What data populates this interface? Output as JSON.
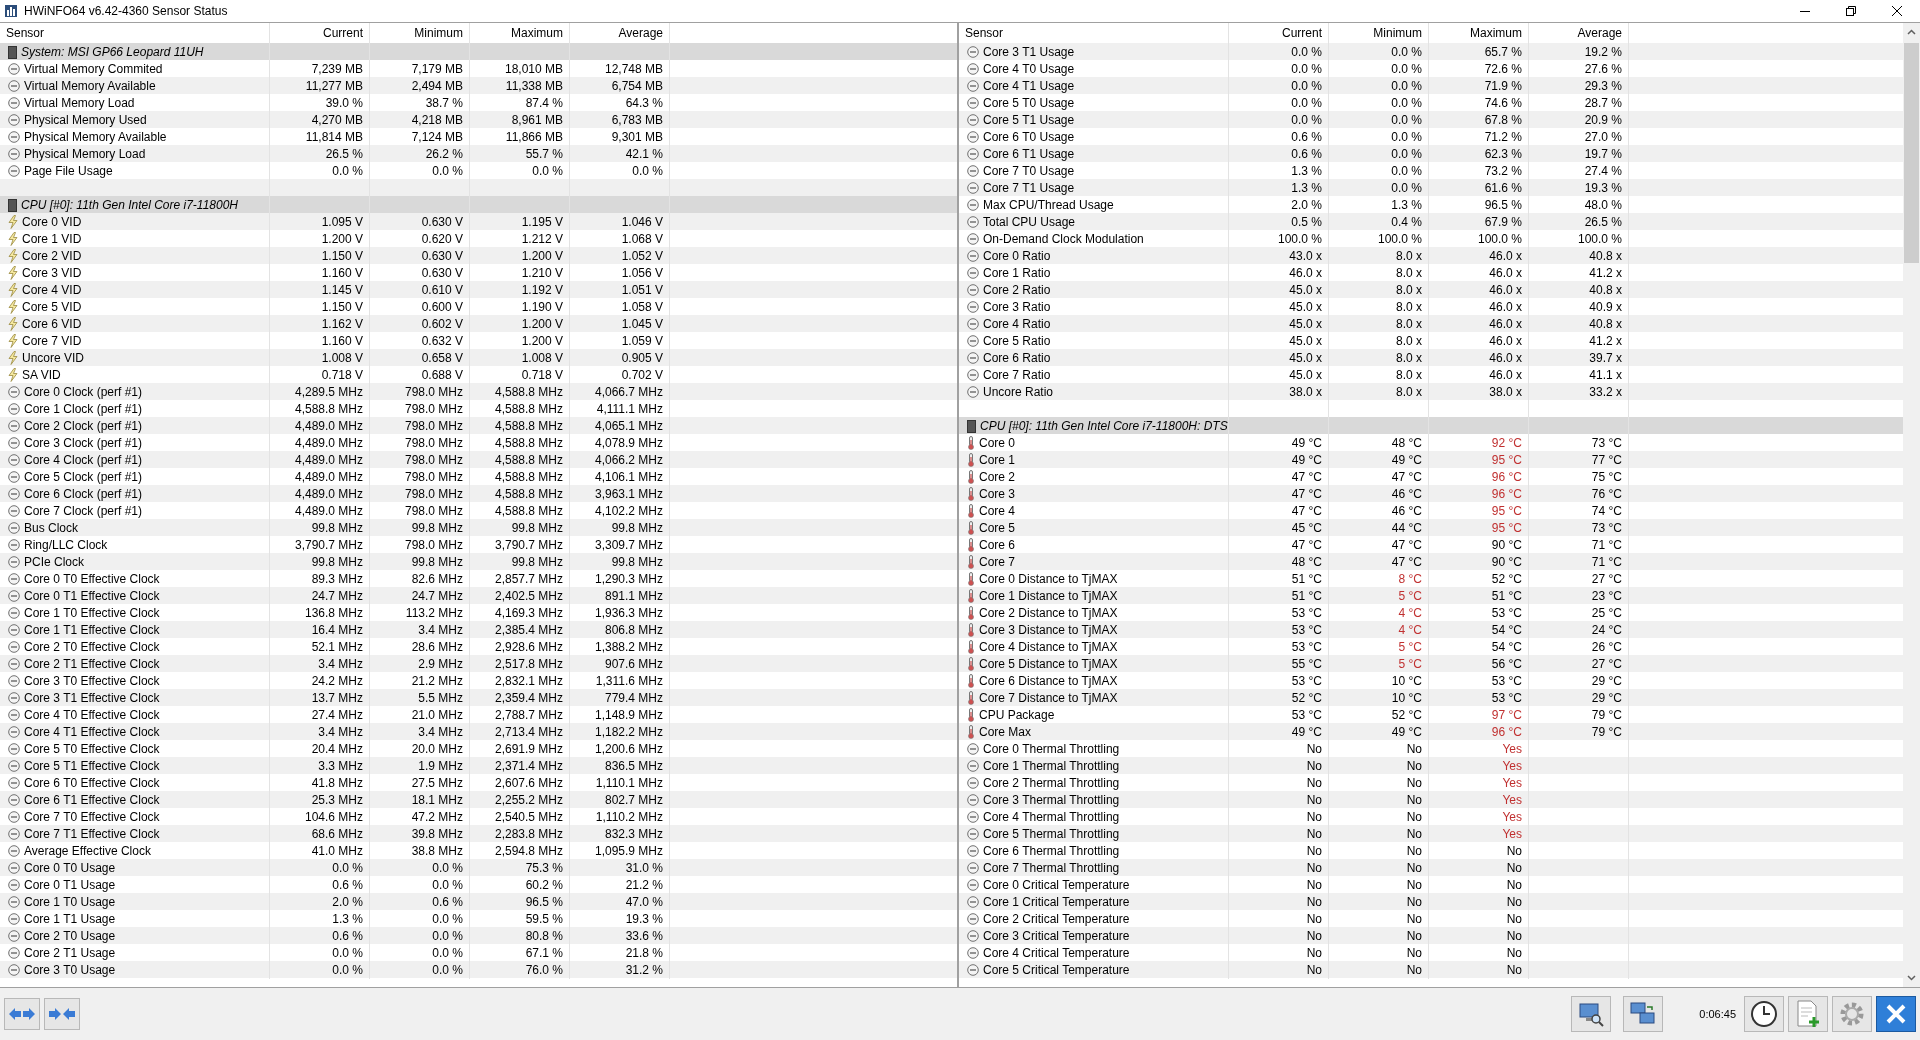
{
  "window": {
    "title": "HWiNFO64 v6.42-4360 Sensor Status"
  },
  "panels": [
    {
      "columns": [
        "Sensor",
        "Current",
        "Minimum",
        "Maximum",
        "Average"
      ],
      "rows": [
        {
          "kind": "group",
          "label": "System: MSI GP66 Leopard 11UH"
        },
        {
          "kind": "gauge",
          "label": "Virtual Memory Commited",
          "current": "7,239 MB",
          "minimum": "7,179 MB",
          "maximum": "18,010 MB",
          "average": "12,748 MB"
        },
        {
          "kind": "gauge",
          "label": "Virtual Memory Available",
          "current": "11,277 MB",
          "minimum": "2,494 MB",
          "maximum": "11,338 MB",
          "average": "6,754 MB"
        },
        {
          "kind": "gauge",
          "label": "Virtual Memory Load",
          "current": "39.0 %",
          "minimum": "38.7 %",
          "maximum": "87.4 %",
          "average": "64.3 %"
        },
        {
          "kind": "gauge",
          "label": "Physical Memory Used",
          "current": "4,270 MB",
          "minimum": "4,218 MB",
          "maximum": "8,961 MB",
          "average": "6,783 MB"
        },
        {
          "kind": "gauge",
          "label": "Physical Memory Available",
          "current": "11,814 MB",
          "minimum": "7,124 MB",
          "maximum": "11,866 MB",
          "average": "9,301 MB"
        },
        {
          "kind": "gauge",
          "label": "Physical Memory Load",
          "current": "26.5 %",
          "minimum": "26.2 %",
          "maximum": "55.7 %",
          "average": "42.1 %"
        },
        {
          "kind": "gauge",
          "label": "Page File Usage",
          "current": "0.0 %",
          "minimum": "0.0 %",
          "maximum": "0.0 %",
          "average": "0.0 %"
        },
        {
          "kind": "blank"
        },
        {
          "kind": "group",
          "label": "CPU [#0]: 11th Gen Intel Core i7-11800H"
        },
        {
          "kind": "voltage",
          "label": "Core 0 VID",
          "current": "1.095 V",
          "minimum": "0.630 V",
          "maximum": "1.195 V",
          "average": "1.046 V"
        },
        {
          "kind": "voltage",
          "label": "Core 1 VID",
          "current": "1.200 V",
          "minimum": "0.620 V",
          "maximum": "1.212 V",
          "average": "1.068 V"
        },
        {
          "kind": "voltage",
          "label": "Core 2 VID",
          "current": "1.150 V",
          "minimum": "0.630 V",
          "maximum": "1.200 V",
          "average": "1.052 V"
        },
        {
          "kind": "voltage",
          "label": "Core 3 VID",
          "current": "1.160 V",
          "minimum": "0.630 V",
          "maximum": "1.210 V",
          "average": "1.056 V"
        },
        {
          "kind": "voltage",
          "label": "Core 4 VID",
          "current": "1.145 V",
          "minimum": "0.610 V",
          "maximum": "1.192 V",
          "average": "1.051 V"
        },
        {
          "kind": "voltage",
          "label": "Core 5 VID",
          "current": "1.150 V",
          "minimum": "0.600 V",
          "maximum": "1.190 V",
          "average": "1.058 V"
        },
        {
          "kind": "voltage",
          "label": "Core 6 VID",
          "current": "1.162 V",
          "minimum": "0.602 V",
          "maximum": "1.200 V",
          "average": "1.045 V"
        },
        {
          "kind": "voltage",
          "label": "Core 7 VID",
          "current": "1.160 V",
          "minimum": "0.632 V",
          "maximum": "1.200 V",
          "average": "1.059 V"
        },
        {
          "kind": "voltage",
          "label": "Uncore VID",
          "current": "1.008 V",
          "minimum": "0.658 V",
          "maximum": "1.008 V",
          "average": "0.905 V"
        },
        {
          "kind": "voltage",
          "label": "SA VID",
          "current": "0.718 V",
          "minimum": "0.688 V",
          "maximum": "0.718 V",
          "average": "0.702 V"
        },
        {
          "kind": "gauge",
          "label": "Core 0 Clock (perf #1)",
          "current": "4,289.5 MHz",
          "minimum": "798.0 MHz",
          "maximum": "4,588.8 MHz",
          "average": "4,066.7 MHz"
        },
        {
          "kind": "gauge",
          "label": "Core 1 Clock (perf #1)",
          "current": "4,588.8 MHz",
          "minimum": "798.0 MHz",
          "maximum": "4,588.8 MHz",
          "average": "4,111.1 MHz"
        },
        {
          "kind": "gauge",
          "label": "Core 2 Clock (perf #1)",
          "current": "4,489.0 MHz",
          "minimum": "798.0 MHz",
          "maximum": "4,588.8 MHz",
          "average": "4,065.1 MHz"
        },
        {
          "kind": "gauge",
          "label": "Core 3 Clock (perf #1)",
          "current": "4,489.0 MHz",
          "minimum": "798.0 MHz",
          "maximum": "4,588.8 MHz",
          "average": "4,078.9 MHz"
        },
        {
          "kind": "gauge",
          "label": "Core 4 Clock (perf #1)",
          "current": "4,489.0 MHz",
          "minimum": "798.0 MHz",
          "maximum": "4,588.8 MHz",
          "average": "4,066.2 MHz"
        },
        {
          "kind": "gauge",
          "label": "Core 5 Clock (perf #1)",
          "current": "4,489.0 MHz",
          "minimum": "798.0 MHz",
          "maximum": "4,588.8 MHz",
          "average": "4,106.1 MHz"
        },
        {
          "kind": "gauge",
          "label": "Core 6 Clock (perf #1)",
          "current": "4,489.0 MHz",
          "minimum": "798.0 MHz",
          "maximum": "4,588.8 MHz",
          "average": "3,963.1 MHz"
        },
        {
          "kind": "gauge",
          "label": "Core 7 Clock (perf #1)",
          "current": "4,489.0 MHz",
          "minimum": "798.0 MHz",
          "maximum": "4,588.8 MHz",
          "average": "4,102.2 MHz"
        },
        {
          "kind": "gauge",
          "label": "Bus Clock",
          "current": "99.8 MHz",
          "minimum": "99.8 MHz",
          "maximum": "99.8 MHz",
          "average": "99.8 MHz"
        },
        {
          "kind": "gauge",
          "label": "Ring/LLC Clock",
          "current": "3,790.7 MHz",
          "minimum": "798.0 MHz",
          "maximum": "3,790.7 MHz",
          "average": "3,309.7 MHz"
        },
        {
          "kind": "gauge",
          "label": "PCIe Clock",
          "current": "99.8 MHz",
          "minimum": "99.8 MHz",
          "maximum": "99.8 MHz",
          "average": "99.8 MHz"
        },
        {
          "kind": "gauge",
          "label": "Core 0 T0 Effective Clock",
          "current": "89.3 MHz",
          "minimum": "82.6 MHz",
          "maximum": "2,857.7 MHz",
          "average": "1,290.3 MHz"
        },
        {
          "kind": "gauge",
          "label": "Core 0 T1 Effective Clock",
          "current": "24.7 MHz",
          "minimum": "24.7 MHz",
          "maximum": "2,402.5 MHz",
          "average": "891.1 MHz"
        },
        {
          "kind": "gauge",
          "label": "Core 1 T0 Effective Clock",
          "current": "136.8 MHz",
          "minimum": "113.2 MHz",
          "maximum": "4,169.3 MHz",
          "average": "1,936.3 MHz"
        },
        {
          "kind": "gauge",
          "label": "Core 1 T1 Effective Clock",
          "current": "16.4 MHz",
          "minimum": "3.4 MHz",
          "maximum": "2,385.4 MHz",
          "average": "806.8 MHz"
        },
        {
          "kind": "gauge",
          "label": "Core 2 T0 Effective Clock",
          "current": "52.1 MHz",
          "minimum": "28.6 MHz",
          "maximum": "2,928.6 MHz",
          "average": "1,388.2 MHz"
        },
        {
          "kind": "gauge",
          "label": "Core 2 T1 Effective Clock",
          "current": "3.4 MHz",
          "minimum": "2.9 MHz",
          "maximum": "2,517.8 MHz",
          "average": "907.6 MHz"
        },
        {
          "kind": "gauge",
          "label": "Core 3 T0 Effective Clock",
          "current": "24.2 MHz",
          "minimum": "21.2 MHz",
          "maximum": "2,832.1 MHz",
          "average": "1,311.6 MHz"
        },
        {
          "kind": "gauge",
          "label": "Core 3 T1 Effective Clock",
          "current": "13.7 MHz",
          "minimum": "5.5 MHz",
          "maximum": "2,359.4 MHz",
          "average": "779.4 MHz"
        },
        {
          "kind": "gauge",
          "label": "Core 4 T0 Effective Clock",
          "current": "27.4 MHz",
          "minimum": "21.0 MHz",
          "maximum": "2,788.7 MHz",
          "average": "1,148.9 MHz"
        },
        {
          "kind": "gauge",
          "label": "Core 4 T1 Effective Clock",
          "current": "3.4 MHz",
          "minimum": "3.4 MHz",
          "maximum": "2,713.4 MHz",
          "average": "1,182.2 MHz"
        },
        {
          "kind": "gauge",
          "label": "Core 5 T0 Effective Clock",
          "current": "20.4 MHz",
          "minimum": "20.0 MHz",
          "maximum": "2,691.9 MHz",
          "average": "1,200.6 MHz"
        },
        {
          "kind": "gauge",
          "label": "Core 5 T1 Effective Clock",
          "current": "3.3 MHz",
          "minimum": "1.9 MHz",
          "maximum": "2,371.4 MHz",
          "average": "836.5 MHz"
        },
        {
          "kind": "gauge",
          "label": "Core 6 T0 Effective Clock",
          "current": "41.8 MHz",
          "minimum": "27.5 MHz",
          "maximum": "2,607.6 MHz",
          "average": "1,110.1 MHz"
        },
        {
          "kind": "gauge",
          "label": "Core 6 T1 Effective Clock",
          "current": "25.3 MHz",
          "minimum": "18.1 MHz",
          "maximum": "2,255.2 MHz",
          "average": "802.7 MHz"
        },
        {
          "kind": "gauge",
          "label": "Core 7 T0 Effective Clock",
          "current": "104.6 MHz",
          "minimum": "47.2 MHz",
          "maximum": "2,540.5 MHz",
          "average": "1,110.2 MHz"
        },
        {
          "kind": "gauge",
          "label": "Core 7 T1 Effective Clock",
          "current": "68.6 MHz",
          "minimum": "39.8 MHz",
          "maximum": "2,283.8 MHz",
          "average": "832.3 MHz"
        },
        {
          "kind": "gauge",
          "label": "Average Effective Clock",
          "current": "41.0 MHz",
          "minimum": "38.8 MHz",
          "maximum": "2,594.8 MHz",
          "average": "1,095.9 MHz"
        },
        {
          "kind": "gauge",
          "label": "Core 0 T0 Usage",
          "current": "0.0 %",
          "minimum": "0.0 %",
          "maximum": "75.3 %",
          "average": "31.0 %"
        },
        {
          "kind": "gauge",
          "label": "Core 0 T1 Usage",
          "current": "0.6 %",
          "minimum": "0.0 %",
          "maximum": "60.2 %",
          "average": "21.2 %"
        },
        {
          "kind": "gauge",
          "label": "Core 1 T0 Usage",
          "current": "2.0 %",
          "minimum": "0.6 %",
          "maximum": "96.5 %",
          "average": "47.0 %"
        },
        {
          "kind": "gauge",
          "label": "Core 1 T1 Usage",
          "current": "1.3 %",
          "minimum": "0.0 %",
          "maximum": "59.5 %",
          "average": "19.3 %"
        },
        {
          "kind": "gauge",
          "label": "Core 2 T0 Usage",
          "current": "0.6 %",
          "minimum": "0.0 %",
          "maximum": "80.8 %",
          "average": "33.6 %"
        },
        {
          "kind": "gauge",
          "label": "Core 2 T1 Usage",
          "current": "0.0 %",
          "minimum": "0.0 %",
          "maximum": "67.1 %",
          "average": "21.8 %"
        },
        {
          "kind": "gauge",
          "label": "Core 3 T0 Usage",
          "current": "0.0 %",
          "minimum": "0.0 %",
          "maximum": "76.0 %",
          "average": "31.2 %"
        }
      ]
    },
    {
      "columns": [
        "Sensor",
        "Current",
        "Minimum",
        "Maximum",
        "Average"
      ],
      "rows": [
        {
          "kind": "gauge",
          "label": "Core 3 T1 Usage",
          "current": "0.0 %",
          "minimum": "0.0 %",
          "maximum": "65.7 %",
          "average": "19.2 %"
        },
        {
          "kind": "gauge",
          "label": "Core 4 T0 Usage",
          "current": "0.0 %",
          "minimum": "0.0 %",
          "maximum": "72.6 %",
          "average": "27.6 %"
        },
        {
          "kind": "gauge",
          "label": "Core 4 T1 Usage",
          "current": "0.0 %",
          "minimum": "0.0 %",
          "maximum": "71.9 %",
          "average": "29.3 %"
        },
        {
          "kind": "gauge",
          "label": "Core 5 T0 Usage",
          "current": "0.0 %",
          "minimum": "0.0 %",
          "maximum": "74.6 %",
          "average": "28.7 %"
        },
        {
          "kind": "gauge",
          "label": "Core 5 T1 Usage",
          "current": "0.0 %",
          "minimum": "0.0 %",
          "maximum": "67.8 %",
          "average": "20.9 %"
        },
        {
          "kind": "gauge",
          "label": "Core 6 T0 Usage",
          "current": "0.6 %",
          "minimum": "0.0 %",
          "maximum": "71.2 %",
          "average": "27.0 %"
        },
        {
          "kind": "gauge",
          "label": "Core 6 T1 Usage",
          "current": "0.6 %",
          "minimum": "0.0 %",
          "maximum": "62.3 %",
          "average": "19.7 %"
        },
        {
          "kind": "gauge",
          "label": "Core 7 T0 Usage",
          "current": "1.3 %",
          "minimum": "0.0 %",
          "maximum": "73.2 %",
          "average": "27.4 %"
        },
        {
          "kind": "gauge",
          "label": "Core 7 T1 Usage",
          "current": "1.3 %",
          "minimum": "0.0 %",
          "maximum": "61.6 %",
          "average": "19.3 %"
        },
        {
          "kind": "gauge",
          "label": "Max CPU/Thread Usage",
          "current": "2.0 %",
          "minimum": "1.3 %",
          "maximum": "96.5 %",
          "average": "48.0 %"
        },
        {
          "kind": "gauge",
          "label": "Total CPU Usage",
          "current": "0.5 %",
          "minimum": "0.4 %",
          "maximum": "67.9 %",
          "average": "26.5 %"
        },
        {
          "kind": "gauge",
          "label": "On-Demand Clock Modulation",
          "current": "100.0 %",
          "minimum": "100.0 %",
          "maximum": "100.0 %",
          "average": "100.0 %"
        },
        {
          "kind": "gauge",
          "label": "Core 0 Ratio",
          "current": "43.0 x",
          "minimum": "8.0 x",
          "maximum": "46.0 x",
          "average": "40.8 x"
        },
        {
          "kind": "gauge",
          "label": "Core 1 Ratio",
          "current": "46.0 x",
          "minimum": "8.0 x",
          "maximum": "46.0 x",
          "average": "41.2 x"
        },
        {
          "kind": "gauge",
          "label": "Core 2 Ratio",
          "current": "45.0 x",
          "minimum": "8.0 x",
          "maximum": "46.0 x",
          "average": "40.8 x"
        },
        {
          "kind": "gauge",
          "label": "Core 3 Ratio",
          "current": "45.0 x",
          "minimum": "8.0 x",
          "maximum": "46.0 x",
          "average": "40.9 x"
        },
        {
          "kind": "gauge",
          "label": "Core 4 Ratio",
          "current": "45.0 x",
          "minimum": "8.0 x",
          "maximum": "46.0 x",
          "average": "40.8 x"
        },
        {
          "kind": "gauge",
          "label": "Core 5 Ratio",
          "current": "45.0 x",
          "minimum": "8.0 x",
          "maximum": "46.0 x",
          "average": "41.2 x"
        },
        {
          "kind": "gauge",
          "label": "Core 6 Ratio",
          "current": "45.0 x",
          "minimum": "8.0 x",
          "maximum": "46.0 x",
          "average": "39.7 x"
        },
        {
          "kind": "gauge",
          "label": "Core 7 Ratio",
          "current": "45.0 x",
          "minimum": "8.0 x",
          "maximum": "46.0 x",
          "average": "41.1 x"
        },
        {
          "kind": "gauge",
          "label": "Uncore Ratio",
          "current": "38.0 x",
          "minimum": "8.0 x",
          "maximum": "38.0 x",
          "average": "33.2 x"
        },
        {
          "kind": "blank"
        },
        {
          "kind": "group",
          "label": "CPU [#0]: 11th Gen Intel Core i7-11800H: DTS"
        },
        {
          "kind": "temperature",
          "label": "Core 0",
          "current": "49 °C",
          "minimum": "48 °C",
          "maximum": "92 °C",
          "average": "73 °C",
          "min_alert": false,
          "max_alert": true
        },
        {
          "kind": "temperature",
          "label": "Core 1",
          "current": "49 °C",
          "minimum": "49 °C",
          "maximum": "95 °C",
          "average": "77 °C",
          "min_alert": false,
          "max_alert": true
        },
        {
          "kind": "temperature",
          "label": "Core 2",
          "current": "47 °C",
          "minimum": "47 °C",
          "maximum": "96 °C",
          "average": "75 °C",
          "min_alert": false,
          "max_alert": true
        },
        {
          "kind": "temperature",
          "label": "Core 3",
          "current": "47 °C",
          "minimum": "46 °C",
          "maximum": "96 °C",
          "average": "76 °C",
          "min_alert": false,
          "max_alert": true
        },
        {
          "kind": "temperature",
          "label": "Core 4",
          "current": "47 °C",
          "minimum": "46 °C",
          "maximum": "95 °C",
          "average": "74 °C",
          "min_alert": false,
          "max_alert": true
        },
        {
          "kind": "temperature",
          "label": "Core 5",
          "current": "45 °C",
          "minimum": "44 °C",
          "maximum": "95 °C",
          "average": "73 °C",
          "min_alert": false,
          "max_alert": true
        },
        {
          "kind": "temperature",
          "label": "Core 6",
          "current": "47 °C",
          "minimum": "47 °C",
          "maximum": "90 °C",
          "average": "71 °C",
          "min_alert": false,
          "max_alert": false
        },
        {
          "kind": "temperature",
          "label": "Core 7",
          "current": "48 °C",
          "minimum": "47 °C",
          "maximum": "90 °C",
          "average": "71 °C",
          "min_alert": false,
          "max_alert": false
        },
        {
          "kind": "temperature",
          "label": "Core 0 Distance to TjMAX",
          "current": "51 °C",
          "minimum": "8 °C",
          "maximum": "52 °C",
          "average": "27 °C",
          "min_alert": true,
          "max_alert": false
        },
        {
          "kind": "temperature",
          "label": "Core 1 Distance to TjMAX",
          "current": "51 °C",
          "minimum": "5 °C",
          "maximum": "51 °C",
          "average": "23 °C",
          "min_alert": true,
          "max_alert": false
        },
        {
          "kind": "temperature",
          "label": "Core 2 Distance to TjMAX",
          "current": "53 °C",
          "minimum": "4 °C",
          "maximum": "53 °C",
          "average": "25 °C",
          "min_alert": true,
          "max_alert": false
        },
        {
          "kind": "temperature",
          "label": "Core 3 Distance to TjMAX",
          "current": "53 °C",
          "minimum": "4 °C",
          "maximum": "54 °C",
          "average": "24 °C",
          "min_alert": true,
          "max_alert": false
        },
        {
          "kind": "temperature",
          "label": "Core 4 Distance to TjMAX",
          "current": "53 °C",
          "minimum": "5 °C",
          "maximum": "54 °C",
          "average": "26 °C",
          "min_alert": true,
          "max_alert": false
        },
        {
          "kind": "temperature",
          "label": "Core 5 Distance to TjMAX",
          "current": "55 °C",
          "minimum": "5 °C",
          "maximum": "56 °C",
          "average": "27 °C",
          "min_alert": true,
          "max_alert": false
        },
        {
          "kind": "temperature",
          "label": "Core 6 Distance to TjMAX",
          "current": "53 °C",
          "minimum": "10 °C",
          "maximum": "53 °C",
          "average": "29 °C",
          "min_alert": false,
          "max_alert": false
        },
        {
          "kind": "temperature",
          "label": "Core 7 Distance to TjMAX",
          "current": "52 °C",
          "minimum": "10 °C",
          "maximum": "53 °C",
          "average": "29 °C",
          "min_alert": false,
          "max_alert": false
        },
        {
          "kind": "temperature",
          "label": "CPU Package",
          "current": "53 °C",
          "minimum": "52 °C",
          "maximum": "97 °C",
          "average": "79 °C",
          "min_alert": false,
          "max_alert": true
        },
        {
          "kind": "temperature",
          "label": "Core Max",
          "current": "49 °C",
          "minimum": "49 °C",
          "maximum": "96 °C",
          "average": "79 °C",
          "min_alert": false,
          "max_alert": true
        },
        {
          "kind": "gauge",
          "label": "Core 0 Thermal Throttling",
          "current": "No",
          "minimum": "No",
          "maximum": "Yes",
          "min_alert": false,
          "max_alert": true
        },
        {
          "kind": "gauge",
          "label": "Core 1 Thermal Throttling",
          "current": "No",
          "minimum": "No",
          "maximum": "Yes",
          "min_alert": false,
          "max_alert": true
        },
        {
          "kind": "gauge",
          "label": "Core 2 Thermal Throttling",
          "current": "No",
          "minimum": "No",
          "maximum": "Yes",
          "min_alert": false,
          "max_alert": true
        },
        {
          "kind": "gauge",
          "label": "Core 3 Thermal Throttling",
          "current": "No",
          "minimum": "No",
          "maximum": "Yes",
          "min_alert": false,
          "max_alert": true
        },
        {
          "kind": "gauge",
          "label": "Core 4 Thermal Throttling",
          "current": "No",
          "minimum": "No",
          "maximum": "Yes",
          "min_alert": false,
          "max_alert": true
        },
        {
          "kind": "gauge",
          "label": "Core 5 Thermal Throttling",
          "current": "No",
          "minimum": "No",
          "maximum": "Yes",
          "min_alert": false,
          "max_alert": true
        },
        {
          "kind": "gauge",
          "label": "Core 6 Thermal Throttling",
          "current": "No",
          "minimum": "No",
          "maximum": "No",
          "min_alert": false,
          "max_alert": false
        },
        {
          "kind": "gauge",
          "label": "Core 7 Thermal Throttling",
          "current": "No",
          "minimum": "No",
          "maximum": "No",
          "min_alert": false,
          "max_alert": false
        },
        {
          "kind": "gauge",
          "label": "Core 0 Critical Temperature",
          "current": "No",
          "minimum": "No",
          "maximum": "No",
          "min_alert": false,
          "max_alert": false
        },
        {
          "kind": "gauge",
          "label": "Core 1 Critical Temperature",
          "current": "No",
          "minimum": "No",
          "maximum": "No",
          "min_alert": false,
          "max_alert": false
        },
        {
          "kind": "gauge",
          "label": "Core 2 Critical Temperature",
          "current": "No",
          "minimum": "No",
          "maximum": "No",
          "min_alert": false,
          "max_alert": false
        },
        {
          "kind": "gauge",
          "label": "Core 3 Critical Temperature",
          "current": "No",
          "minimum": "No",
          "maximum": "No",
          "min_alert": false,
          "max_alert": false
        },
        {
          "kind": "gauge",
          "label": "Core 4 Critical Temperature",
          "current": "No",
          "minimum": "No",
          "maximum": "No",
          "min_alert": false,
          "max_alert": false
        },
        {
          "kind": "gauge",
          "label": "Core 5 Critical Temperature",
          "current": "No",
          "minimum": "No",
          "maximum": "No",
          "min_alert": false,
          "max_alert": false
        }
      ]
    }
  ],
  "status_bar": {
    "elapsed": "0:06:45"
  }
}
